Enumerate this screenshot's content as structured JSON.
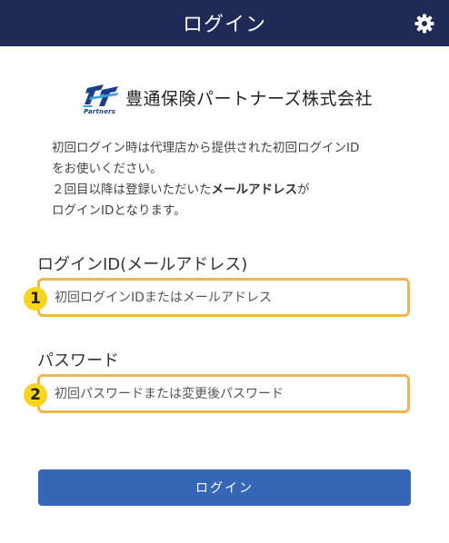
{
  "header": {
    "title": "ログイン",
    "settings_icon": "gear-icon",
    "background": "#1f2a56"
  },
  "logo": {
    "tagline": "Partners",
    "company_name": "豊通保険パートナーズ株式会社",
    "accent": "#1c3c8c"
  },
  "intro": {
    "line1": "初回ログイン時は代理店から提供された初回ログインID",
    "line2": "をお使いください。",
    "line3_prefix": "２回目以降は登録いただいた",
    "line3_bold": "メールアドレス",
    "line3_suffix": "が",
    "line4": "ログインIDとなります。"
  },
  "login_id": {
    "label": "ログインID(メールアドレス)",
    "badge": "1",
    "placeholder": "初回ログインIDまたはメールアドレス",
    "value": ""
  },
  "password": {
    "label": "パスワード",
    "badge": "2",
    "placeholder": "初回パスワードまたは変更後パスワード",
    "value": ""
  },
  "submit": {
    "label": "ログイン"
  },
  "colors": {
    "highlight_border": "#f0b84c",
    "badge": "#f7d51f",
    "button": "#3567b6"
  }
}
